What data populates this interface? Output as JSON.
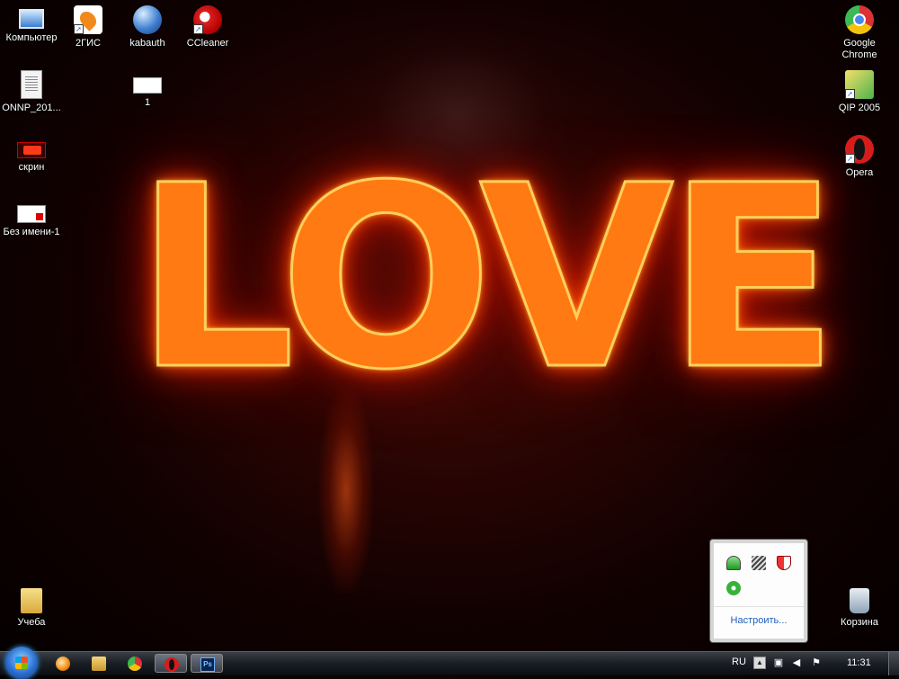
{
  "desktop": {
    "icons_left": [
      {
        "label": "Компьютер",
        "icon": "computer-icon"
      },
      {
        "label": "2ГИС",
        "icon": "2gis-icon"
      },
      {
        "label": "kabauth",
        "icon": "globe-icon"
      },
      {
        "label": "CCleaner",
        "icon": "ccleaner-icon"
      },
      {
        "label": "ONNP_201...",
        "icon": "document-icon"
      },
      {
        "label": "1",
        "icon": "image-file-icon"
      },
      {
        "label": "скрин",
        "icon": "screenshot-file-icon"
      },
      {
        "label": "Без имени-1",
        "icon": "psd-file-icon"
      },
      {
        "label": "Учеба",
        "icon": "folder-icon"
      }
    ],
    "icons_right": [
      {
        "label": "Google Chrome",
        "icon": "chrome-icon"
      },
      {
        "label": "QIP 2005",
        "icon": "qip-icon"
      },
      {
        "label": "Opera",
        "icon": "opera-icon"
      },
      {
        "label": "Корзина",
        "icon": "recycle-bin-icon"
      }
    ],
    "wallpaper_text": "LOVE"
  },
  "tray_popup": {
    "icons": [
      "network-icon",
      "rss-icon",
      "shield-icon",
      "clover-icon"
    ],
    "customize_label": "Настроить..."
  },
  "taskbar": {
    "start_icon": "windows-start-icon",
    "pinned": [
      "ccleaner-icon",
      "explorer-icon",
      "chrome-icon",
      "opera-icon",
      "photoshop-icon"
    ],
    "photoshop_glyph": "Ps",
    "language": "RU",
    "clock": "11:31",
    "tray_icons": [
      "show-hidden-icons-arrow",
      "network-icon",
      "volume-icon",
      "action-center-flag-icon"
    ]
  }
}
